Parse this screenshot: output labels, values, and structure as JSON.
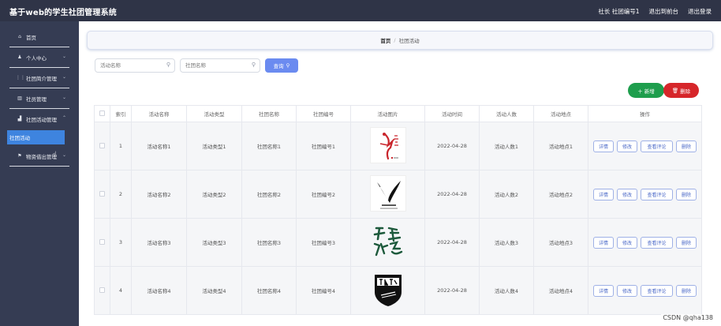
{
  "header": {
    "app_title": "基于web的学生社团管理系统",
    "user_info": "社长 社团编号1",
    "back_link": "退出到前台",
    "logout_link": "退出登录"
  },
  "sidebar": {
    "items": [
      {
        "icon": "home-icon",
        "label": "首页",
        "has_chevron": false
      },
      {
        "icon": "user-icon",
        "label": "个人中心",
        "has_chevron": true
      },
      {
        "icon": "grid-icon",
        "label": "社团简介管理",
        "has_chevron": true
      },
      {
        "icon": "building-icon",
        "label": "社员管理",
        "has_chevron": true
      },
      {
        "icon": "chart-icon",
        "label": "社团活动管理",
        "has_chevron": true
      }
    ],
    "active_subitem": "社团活动",
    "last_item": {
      "icon": "flag-icon",
      "label": "物资借出管理",
      "has_chevron": true
    }
  },
  "breadcrumb": {
    "home": "首页",
    "separator": "/",
    "current": "社团活动"
  },
  "search": {
    "activity_placeholder": "活动名称",
    "club_placeholder": "社团名称",
    "button_label": "查询"
  },
  "actions": {
    "add_label": "新增",
    "delete_label": "删除"
  },
  "table": {
    "headers": [
      "索引",
      "活动名称",
      "活动类型",
      "社团名称",
      "社团编号",
      "活动图片",
      "活动时间",
      "活动人数",
      "活动地点",
      "操作"
    ],
    "rows": [
      {
        "index": "1",
        "name": "活动名称1",
        "type": "活动类型1",
        "club": "社团名称1",
        "club_no": "社团编号1",
        "image": "dance-logo",
        "time": "2022-04-28",
        "people": "活动人数1",
        "place": "活动地点1"
      },
      {
        "index": "2",
        "name": "活动名称2",
        "type": "活动类型2",
        "club": "社团名称2",
        "club_no": "社团编号2",
        "image": "art-logo",
        "time": "2022-04-28",
        "people": "活动人数2",
        "place": "活动地点2"
      },
      {
        "index": "3",
        "name": "活动名称3",
        "type": "活动类型3",
        "club": "社团名称3",
        "club_no": "社团编号3",
        "image": "calligraphy-logo",
        "time": "2022-04-28",
        "people": "活动人数3",
        "place": "活动地点3"
      },
      {
        "index": "4",
        "name": "活动名称4",
        "type": "活动类型4",
        "club": "社团名称4",
        "club_no": "社团编号4",
        "image": "guitar-logo",
        "time": "2022-04-28",
        "people": "活动人数4",
        "place": "活动地点4"
      }
    ],
    "row_buttons": {
      "detail": "详情",
      "edit": "修改",
      "comments": "查看评论",
      "delete": "删除"
    }
  },
  "watermark": "CSDN @qha138",
  "colors": {
    "topbar": "#2f3447",
    "sidebar": "#353c53",
    "active_menu": "#3e84df",
    "search_button": "#6b8bf0",
    "add_button": "#1e9e4d",
    "delete_button": "#d6262a"
  }
}
